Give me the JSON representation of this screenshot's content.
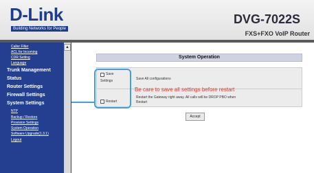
{
  "header": {
    "logo": "D-Link",
    "tagline": "Building Networks for People",
    "model": "DVG-7022S",
    "model_subtitle": "FXS+FXO VoIP Router"
  },
  "sidebar": {
    "items": [
      {
        "label": "Caller Filter",
        "kind": "sub"
      },
      {
        "label": "ACL for Incoming",
        "kind": "sub"
      },
      {
        "label": "CDR Setting",
        "kind": "sub"
      },
      {
        "label": "Language",
        "kind": "sub"
      },
      {
        "label": "Trunk Management",
        "kind": "main"
      },
      {
        "label": "Status",
        "kind": "main"
      },
      {
        "label": "Router Settings",
        "kind": "main"
      },
      {
        "label": "Firewall Settings",
        "kind": "main"
      },
      {
        "label": "System Settings",
        "kind": "main"
      },
      {
        "label": "NTP",
        "kind": "sub"
      },
      {
        "label": "Backup / Restore",
        "kind": "sub"
      },
      {
        "label": "Provision Settings",
        "kind": "sub"
      },
      {
        "label": "System Operation",
        "kind": "sub"
      },
      {
        "label": "Software Upgrade(1.3.1)",
        "kind": "sub"
      },
      {
        "label": "Logout",
        "kind": "sub"
      }
    ]
  },
  "main": {
    "title": "System Operation",
    "save": {
      "checkbox_label_1": "Save",
      "checkbox_label_2": "Settings",
      "description": "Save All configurations",
      "checked": false
    },
    "warning": "Be care to save all settings before restart",
    "restart": {
      "checkbox_label": "Restart",
      "description_1": "Restart the Gateway right away. All calls will be DROP PBO when",
      "description_2": "Restart",
      "checked": false
    },
    "accept_label": "Accept"
  },
  "colors": {
    "sidebar": "#243f8f",
    "title_bar": "#cfd2e2",
    "warning": "#d63a2a",
    "callout": "#3f9fe0"
  }
}
